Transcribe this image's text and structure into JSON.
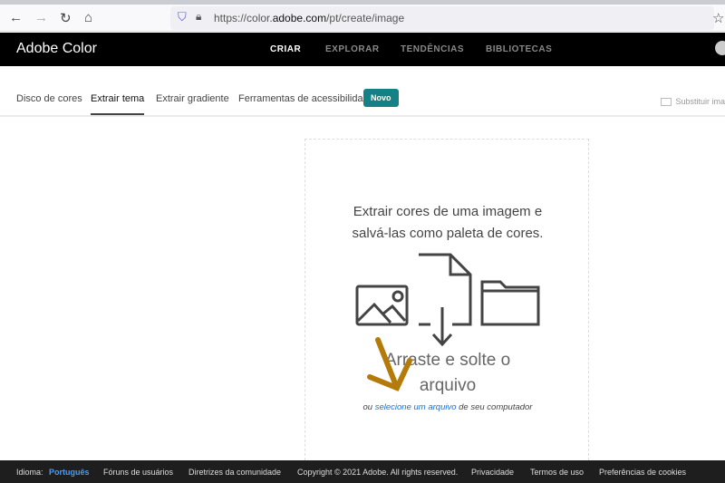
{
  "browser": {
    "url_prefix": "https://color.",
    "url_domain": "adobe.com",
    "url_path": "/pt/create/image"
  },
  "app": {
    "logo": "Adobe Color",
    "nav": [
      "CRIAR",
      "EXPLORAR",
      "TENDÊNCIAS",
      "BIBLIOTECAS"
    ]
  },
  "tabs": {
    "items": [
      "Disco de cores",
      "Extrair tema",
      "Extrair gradiente",
      "Ferramentas de acessibilidade"
    ],
    "active": "Extrair tema",
    "badge": "Novo",
    "replace": "Substituir ima"
  },
  "drop": {
    "line1": "Extrair cores de uma imagem e",
    "line2": "salvá-las como paleta de cores.",
    "drag1": "Arraste e solte o",
    "drag2": "arquivo",
    "or": "ou",
    "link": "selecione um arquivo",
    "suffix": "de seu computador"
  },
  "footer": {
    "lang_label": "Idioma:",
    "lang": "Português",
    "forums": "Fóruns de usuários",
    "guidelines": "Diretrizes da comunidade",
    "copyright": "Copyright © 2021 Adobe. All rights reserved.",
    "privacy": "Privacidade",
    "terms": "Termos de uso",
    "cookies": "Preferências de cookies"
  },
  "colors": {
    "accent": "#138185",
    "link": "#1473e6",
    "annotation": "#b47a0a"
  }
}
